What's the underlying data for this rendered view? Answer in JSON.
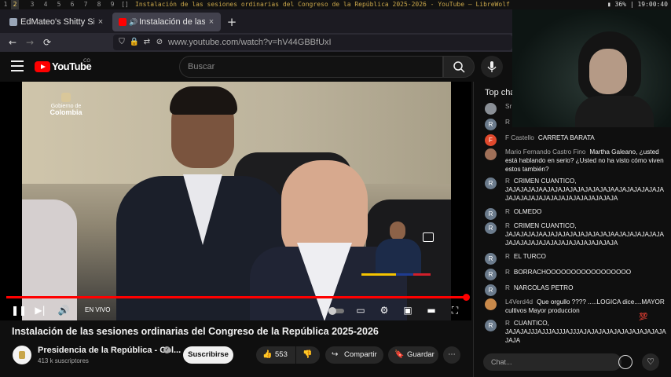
{
  "wm": {
    "workspaces": [
      "1",
      "2",
      "3",
      "4",
      "5",
      "6",
      "7",
      "8",
      "9"
    ],
    "active_workspace": "2",
    "layout_indicator": "[]",
    "window_title": "Instalación de las sesiones ordinarias del Congreso de la República 2025-2026 - YouTube — LibreWolf",
    "battery": "36%",
    "clock": "19:00:40"
  },
  "browser": {
    "tabs": [
      {
        "label": "EdMateo's Shitty Site",
        "close": "×",
        "active": false
      },
      {
        "label": "Instalación de las sesiones",
        "close": "×",
        "active": true
      }
    ],
    "new_tab": "+",
    "url": "www.youtube.com/watch?v=hV44GBBfUxI",
    "nav": {
      "back": "←",
      "forward": "→",
      "reload": "⟳"
    }
  },
  "youtube": {
    "logo_text": "YouTube",
    "logo_region": "CO",
    "search_placeholder": "Buscar"
  },
  "video": {
    "overlay_logo_line1": "Gobierno de",
    "overlay_logo_line2": "Colombia",
    "live_label": "EN VIVO",
    "title": "Instalación de las sesiones ordinarias del Congreso de la República 2025-2026",
    "progress_fraction": 1.0
  },
  "channel": {
    "name": "Presidencia de la República - Col...",
    "subscribers": "413 k suscriptores",
    "subscribe_label": "Suscribirse"
  },
  "actions": {
    "like_count": "553",
    "share_label": "Compartir",
    "save_label": "Guardar",
    "more_label": "⋯"
  },
  "chat": {
    "header": "Top cha",
    "messages": [
      {
        "avatar": "",
        "author": "Sr",
        "text": ""
      },
      {
        "avatar": "R",
        "author": "R",
        "text": ""
      },
      {
        "avatar": "F",
        "author": "F Castello",
        "text": "CARRETA BARATA"
      },
      {
        "avatar": "",
        "author": "Mario Fernando Castro Fino",
        "text": "Martha Galeano, ¿usted está hablando en serio? ¿Usted no ha visto cómo viven estos también?"
      },
      {
        "avatar": "R",
        "author": "R",
        "text": "CRIMEN CUANTICO, JAJAJAJAJAAJAJAJAJAJAJAJAJAJAAJAJAJAJAJAJAJAJAJAJAJAJAJAJAJAJAJAJAJAJAJA"
      },
      {
        "avatar": "R",
        "author": "R",
        "text": "OLMEDO"
      },
      {
        "avatar": "R",
        "author": "R",
        "text": "CRIMEN CUANTICO, JAJAJAJAJAAJAJAJAJAJAJAJAJAJAAJAJAJAJAJAJAJAJAJAJAJAJAJAJAJAJAJAJAJAJAJA"
      },
      {
        "avatar": "R",
        "author": "R",
        "text": "EL TURCO"
      },
      {
        "avatar": "R",
        "author": "R",
        "text": "BORRACHOOOOOOOOOOOOOOOOO"
      },
      {
        "avatar": "R",
        "author": "R",
        "text": "NARCOLAS PETRO"
      },
      {
        "avatar": "",
        "author": "L4Verd4d",
        "text": "Que orgullo ???? .....LOGICA dice....MAYOR cultivos Mayor produccion"
      },
      {
        "avatar": "R",
        "author": "R",
        "text": "CUANTICO, JAJAJAJJJAJJJAJJJAJJJAJAJAJAJAJAJAJAJAJAJAJAJAJA"
      }
    ],
    "input_placeholder": "Chat...",
    "hundred_emoji": "💯"
  },
  "colors": {
    "yt_red": "#ff0000",
    "bg": "#0f0f0f",
    "tab_active": "#42414d"
  }
}
